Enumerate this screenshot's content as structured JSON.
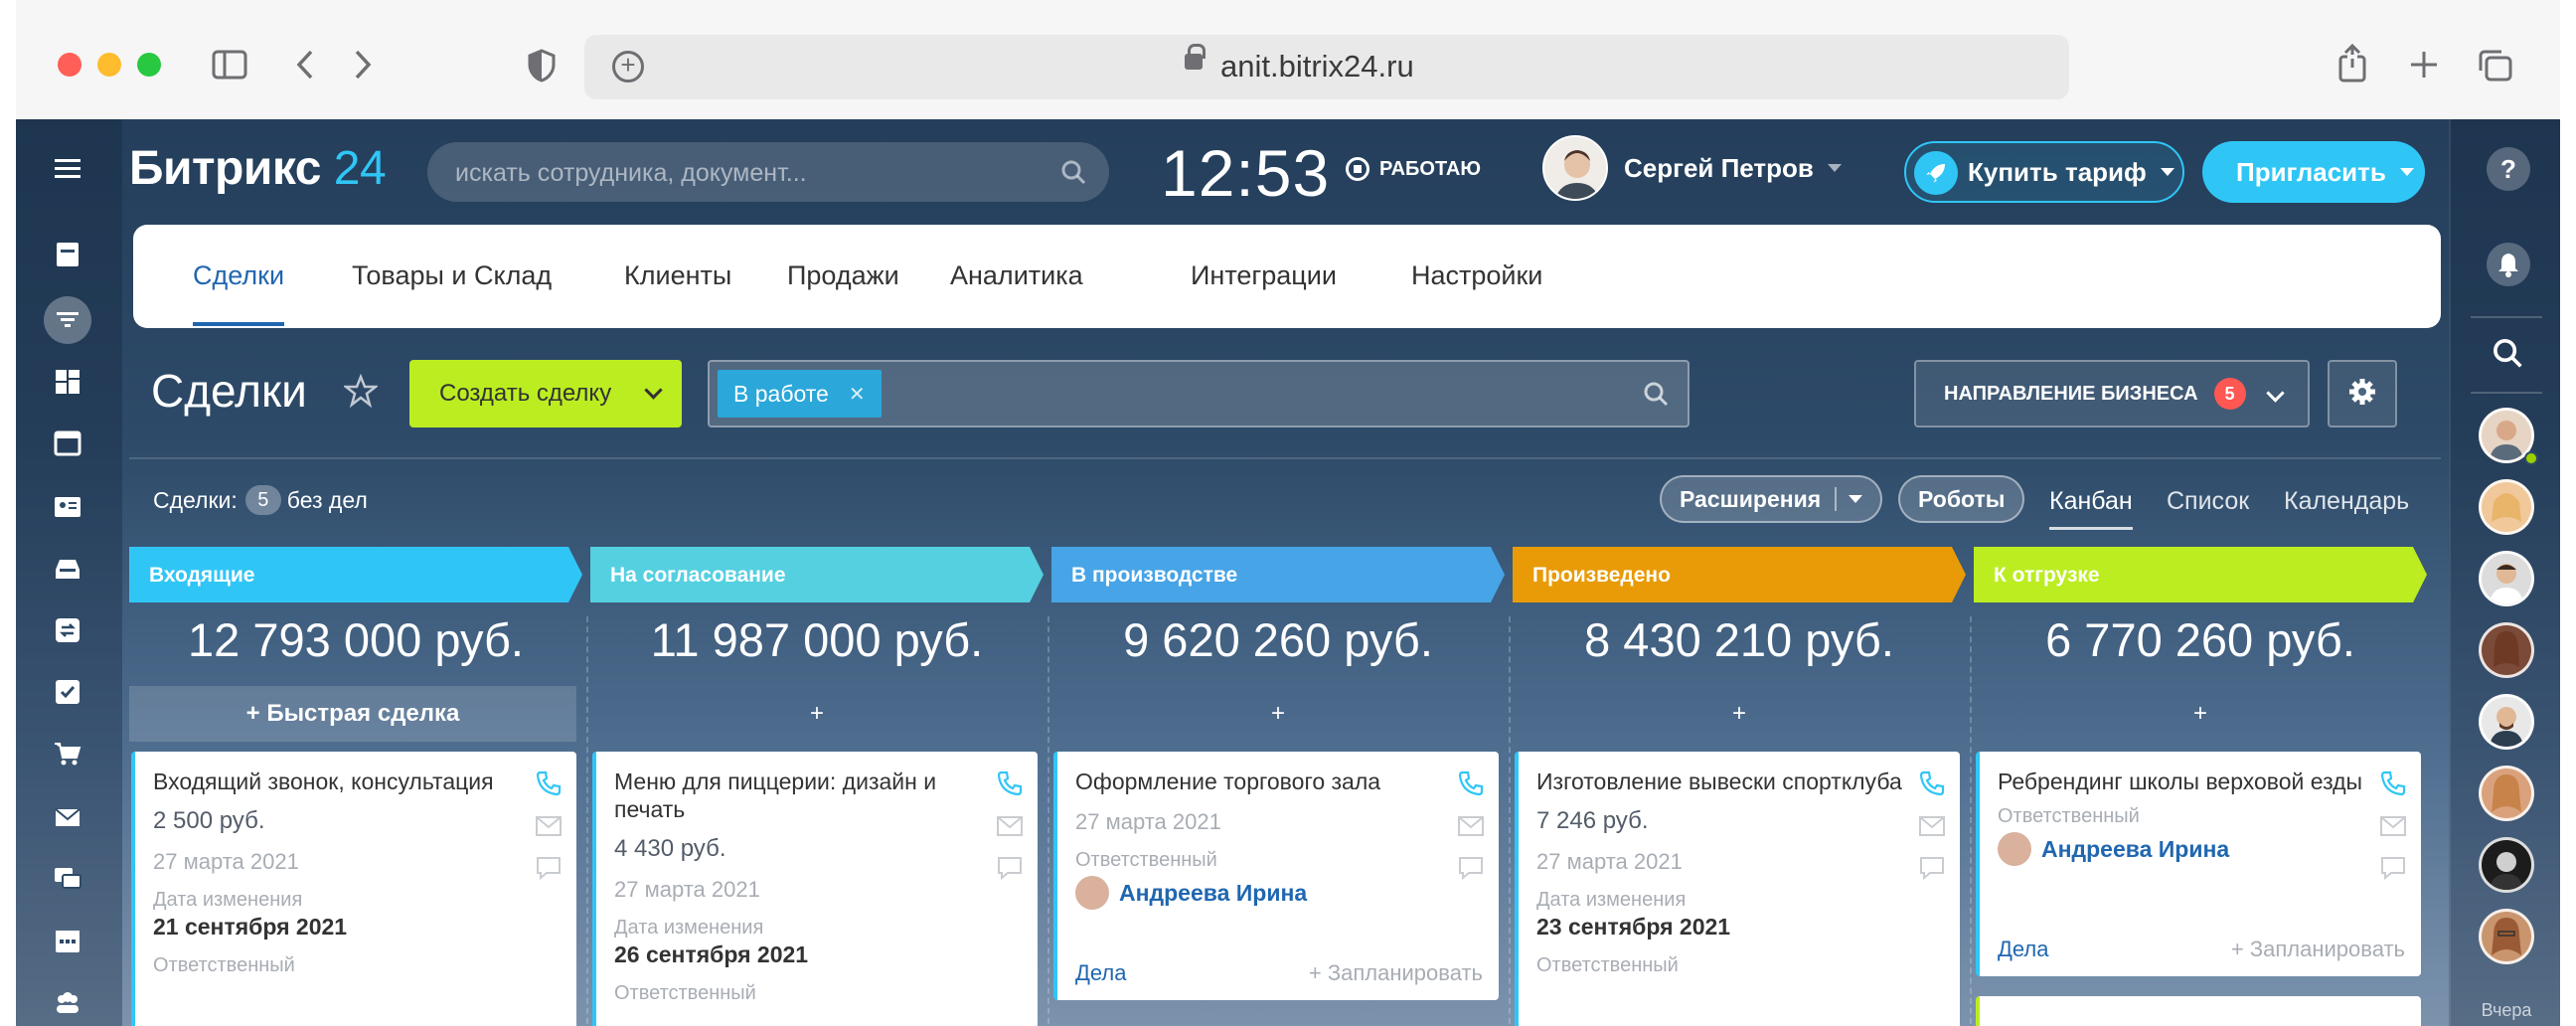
{
  "browser": {
    "url": "anit.bitrix24.ru",
    "colors": {
      "close": "#ff5f57",
      "minimize": "#febc2e",
      "maximize": "#28c840"
    }
  },
  "header": {
    "logo_main": "Битрикс",
    "logo_num": "24",
    "search_placeholder": "искать сотрудника, документ...",
    "clock": "12:53",
    "work_status": "РАБОТАЮ",
    "user_name": "Сергей Петров",
    "buy_label": "Купить тариф",
    "invite_label": "Пригласить"
  },
  "tabs": [
    "Сделки",
    "Товары и Склад",
    "Клиенты",
    "Продажи",
    "Аналитика",
    "Интеграции",
    "Настройки"
  ],
  "page": {
    "title": "Сделки",
    "create_label": "Создать сделку",
    "filter_chip": "В работе",
    "direction_label": "НАПРАВЛЕНИЕ БИЗНЕСА",
    "direction_count": "5",
    "deals_label": "Сделки:",
    "deals_count": "5",
    "deals_suffix": "без дел",
    "extensions_label": "Расширения",
    "robots_label": "Роботы",
    "views": [
      "Канбан",
      "Список",
      "Календарь"
    ],
    "quick_deal": "Быстрая сделка",
    "plus": "+"
  },
  "columns": [
    {
      "name": "Входящие",
      "color": "#2fc6f6",
      "sum": "12 793 000 руб."
    },
    {
      "name": "На согласование",
      "color": "#55d0e0",
      "sum": "11 987 000 руб."
    },
    {
      "name": "В производстве",
      "color": "#47a4e6",
      "sum": "9 620 260 руб."
    },
    {
      "name": "Произведено",
      "color": "#e89b06",
      "sum": "8 430 210 руб."
    },
    {
      "name": "К отгрузке",
      "color": "#bbed21",
      "sum": "6 770 260 руб."
    }
  ],
  "cards": [
    {
      "title": "Входящий звонок, консультация",
      "price": "2 500 руб.",
      "date": "27 марта 2021",
      "changed_label": "Дата изменения",
      "changed": "21 сентября 2021",
      "resp_label": "Ответственный"
    },
    {
      "title": "Меню для пиццерии: дизайн и печать",
      "price": "4 430 руб.",
      "date": "27 марта 2021",
      "changed_label": "Дата изменения",
      "changed": "26 сентября 2021",
      "resp_label": "Ответственный"
    },
    {
      "title": "Оформление торгового зала",
      "date": "27 марта 2021",
      "resp_label": "Ответственный",
      "resp": "Андреева Ирина",
      "tasks": "Дела",
      "plan": "+ Запланировать"
    },
    {
      "title": "Изготовление вывески спортклуба",
      "price": "7 246 руб.",
      "date": "27 марта 2021",
      "changed_label": "Дата изменения",
      "changed": "23 сентября 2021",
      "resp_label": "Ответственный"
    },
    {
      "title": "Ребрендинг школы верховой езды",
      "resp_label": "Ответственный",
      "resp": "Андреева Ирина",
      "tasks": "Дела",
      "plan": "+ Запланировать"
    }
  ],
  "right_sidebar": {
    "bottom_label": "Вчера"
  },
  "icons": [
    "menu-icon",
    "sidebar-icon",
    "back-icon",
    "forward-icon",
    "shield-icon",
    "share-icon",
    "new-tab-icon",
    "tabs-icon",
    "help-icon",
    "bell-icon",
    "search-icon",
    "gear-icon",
    "star-icon",
    "phone-icon",
    "mail-icon",
    "chat-icon"
  ]
}
